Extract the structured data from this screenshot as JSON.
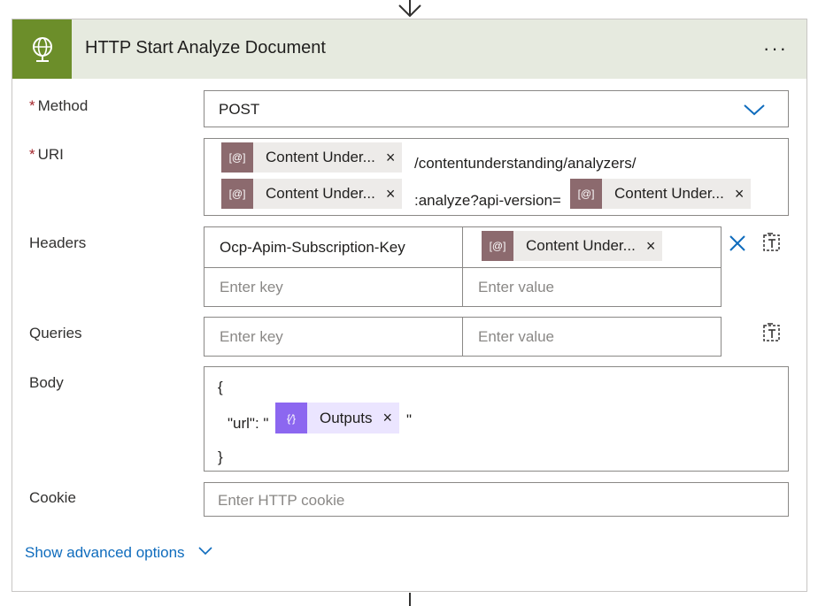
{
  "card": {
    "title": "HTTP Start Analyze Document",
    "more_label": "···",
    "icon": "globe-icon",
    "header_color": "#6c8e2a"
  },
  "fields": {
    "method": {
      "label": "Method",
      "required": "*",
      "value": "POST"
    },
    "uri": {
      "label": "URI",
      "required": "*",
      "tokens": [
        "Content Under...",
        "Content Under...",
        "Content Under..."
      ],
      "segments": [
        "/contentunderstanding/analyzers/",
        ":analyze?api-version="
      ]
    },
    "headers": {
      "label": "Headers",
      "rows": [
        {
          "key": "Ocp-Apim-Subscription-Key",
          "value_token": "Content Under..."
        }
      ],
      "key_placeholder": "Enter key",
      "value_placeholder": "Enter value"
    },
    "queries": {
      "label": "Queries",
      "key_placeholder": "Enter key",
      "value_placeholder": "Enter value"
    },
    "body": {
      "label": "Body",
      "line1": "{",
      "line2_prefix": "\"url\": \"",
      "token": "Outputs",
      "line2_suffix": "\"",
      "line3": "}"
    },
    "cookie": {
      "label": "Cookie",
      "placeholder": "Enter HTTP cookie"
    }
  },
  "advanced": {
    "label": "Show advanced options"
  },
  "colors": {
    "link": "#0f6cbd",
    "token_icon": "#8c6a6e",
    "outputs_icon": "#8c67f0",
    "required": "#a4262c"
  }
}
